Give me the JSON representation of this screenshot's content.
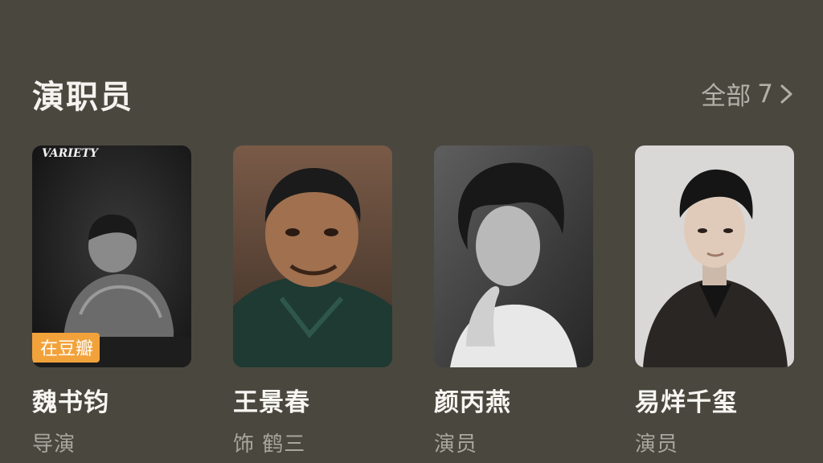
{
  "section": {
    "title": "演职员",
    "view_all_label": "全部",
    "view_all_count": "7"
  },
  "cast": [
    {
      "name": "魏书钧",
      "role": "导演",
      "badge": "在豆瓣",
      "photo_caption": "VARIETY"
    },
    {
      "name": "王景春",
      "role": "饰 鹤三"
    },
    {
      "name": "颜丙燕",
      "role": "演员"
    },
    {
      "name": "易烊千玺",
      "role": "演员"
    }
  ],
  "colors": {
    "background": "#4a473f",
    "badge": "#f2a23a",
    "muted_text": "#a9a69e"
  }
}
